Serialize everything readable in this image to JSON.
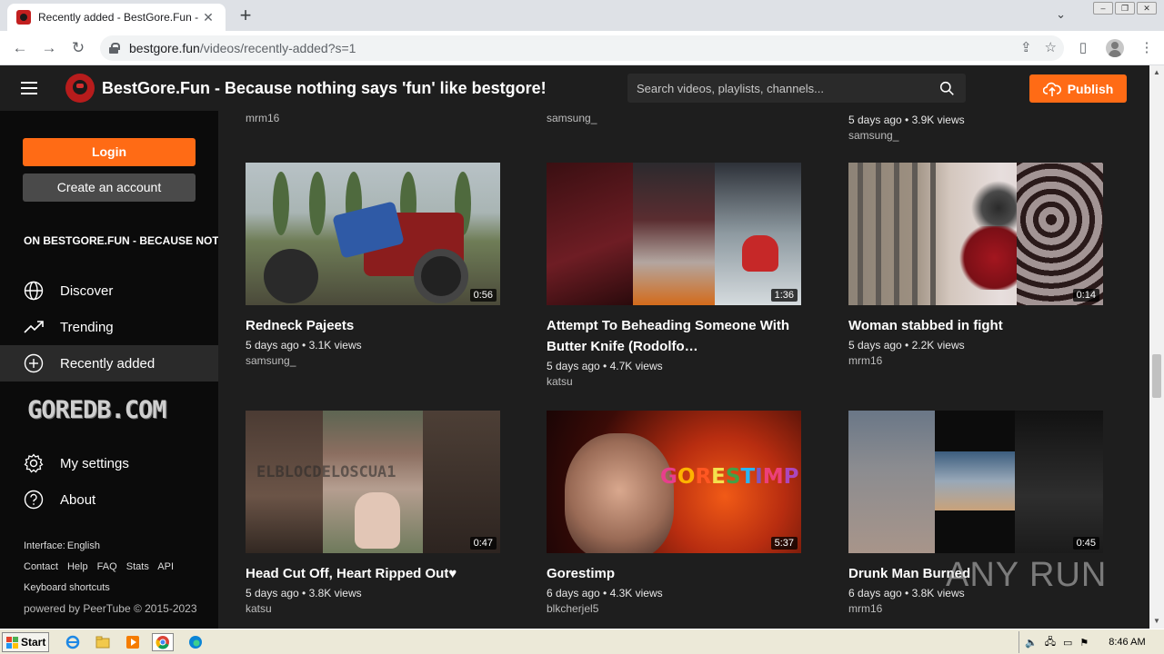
{
  "browser": {
    "tab_title": "Recently added - BestGore.Fun - Be",
    "url_host": "bestgore.fun",
    "url_path": "/videos/recently-added?s=1"
  },
  "header": {
    "site_title": "BestGore.Fun - Because nothing says 'fun' like bestgore!",
    "search_placeholder": "Search videos, playlists, channels...",
    "publish_label": "Publish"
  },
  "sidebar": {
    "login_label": "Login",
    "create_account_label": "Create an account",
    "instance_banner": "ON BESTGORE.FUN - BECAUSE NOTHING SAYS 'FUN' LIKE BESTGORE!",
    "items": [
      {
        "label": "Discover",
        "icon": "globe-icon"
      },
      {
        "label": "Trending",
        "icon": "trending-icon"
      },
      {
        "label": "Recently added",
        "icon": "plus-circle-icon"
      }
    ],
    "banner_text": "GOREDB.COM",
    "settings_label": "My settings",
    "about_label": "About",
    "interface_label": "Interface:",
    "interface_value": "English",
    "footer_links": [
      "Contact",
      "Help",
      "FAQ",
      "Stats",
      "API"
    ],
    "shortcuts_label": "Keyboard shortcuts",
    "powered_by": "powered by PeerTube © 2015-2023"
  },
  "partial_row": [
    {
      "channel": "mrm16"
    },
    {
      "channel": "samsung_"
    },
    {
      "meta": "5 days ago • 3.9K views",
      "channel": "samsung_"
    }
  ],
  "videos": [
    {
      "title": "Redneck Pajeets",
      "meta": "5 days ago • 3.1K views",
      "channel": "samsung_",
      "duration": "0:56"
    },
    {
      "title": "Attempt To Beheading Someone With Butter Knife (Rodolfo…",
      "meta": "5 days ago • 4.7K views",
      "channel": "katsu",
      "duration": "1:36"
    },
    {
      "title": "Woman stabbed in fight",
      "meta": "5 days ago • 2.2K views",
      "channel": "mrm16",
      "duration": "0:14"
    },
    {
      "title": "Head Cut Off, Heart Ripped Out♥",
      "meta": "5 days ago • 3.8K views",
      "channel": "katsu",
      "duration": "0:47"
    },
    {
      "title": "Gorestimp",
      "meta": "6 days ago • 4.3K views",
      "channel": "blkcherjel5",
      "duration": "5:37"
    },
    {
      "title": "Drunk Man Burned",
      "meta": "6 days ago • 3.8K views",
      "channel": "mrm16",
      "duration": "0:45"
    }
  ],
  "thumb_text": {
    "watermark": "ELBLOCDELOSCUA1",
    "gorestimp": "GORESTIMP"
  },
  "watermark": "ANY RUN",
  "taskbar": {
    "start_label": "Start",
    "clock": "8:46 AM"
  },
  "colors": {
    "accent": "#ff6b15",
    "background": "#1e1e1e",
    "sidebar": "#0b0b0b"
  }
}
